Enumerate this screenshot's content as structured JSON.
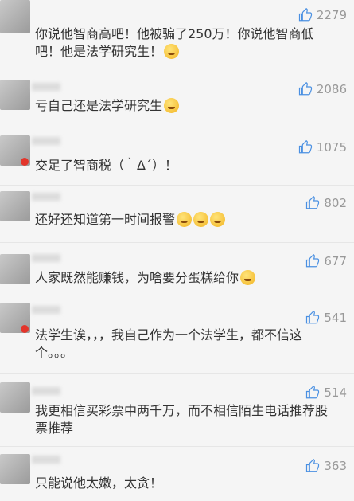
{
  "comments": [
    {
      "likes": "2279",
      "text": "你说他智商高吧！他被骗了250万！你说他智商低吧！他是法学研究生！",
      "emoji": "emoji-face",
      "emoji_count": 1
    },
    {
      "likes": "2086",
      "text": "亏自己还是法学研究生",
      "emoji": "emoji-laugh-cry",
      "emoji_count": 1
    },
    {
      "likes": "1075",
      "text": "交足了智商税（｀Δ´）！",
      "emoji": "",
      "emoji_count": 0
    },
    {
      "likes": "802",
      "text": "还好还知道第一时间报警",
      "emoji": "emoji-laugh",
      "emoji_count": 3
    },
    {
      "likes": "677",
      "text": "人家既然能赚钱，为啥要分蛋糕给你",
      "emoji": "emoji-smile",
      "emoji_count": 1
    },
    {
      "likes": "541",
      "text": "法学生诶，，，我自己作为一个法学生，都不信这个。。。",
      "emoji": "",
      "emoji_count": 0
    },
    {
      "likes": "514",
      "text": "我更相信买彩票中两千万，而不相信陌生电话推荐股票推荐",
      "emoji": "",
      "emoji_count": 0
    },
    {
      "likes": "363",
      "text": "只能说他太嫩，太贪！",
      "emoji": "",
      "emoji_count": 0
    }
  ],
  "icons": {
    "like": "thumbs-up-icon"
  },
  "colors": {
    "background": "#f5f5f5",
    "text": "#333333",
    "meta": "#999999"
  }
}
